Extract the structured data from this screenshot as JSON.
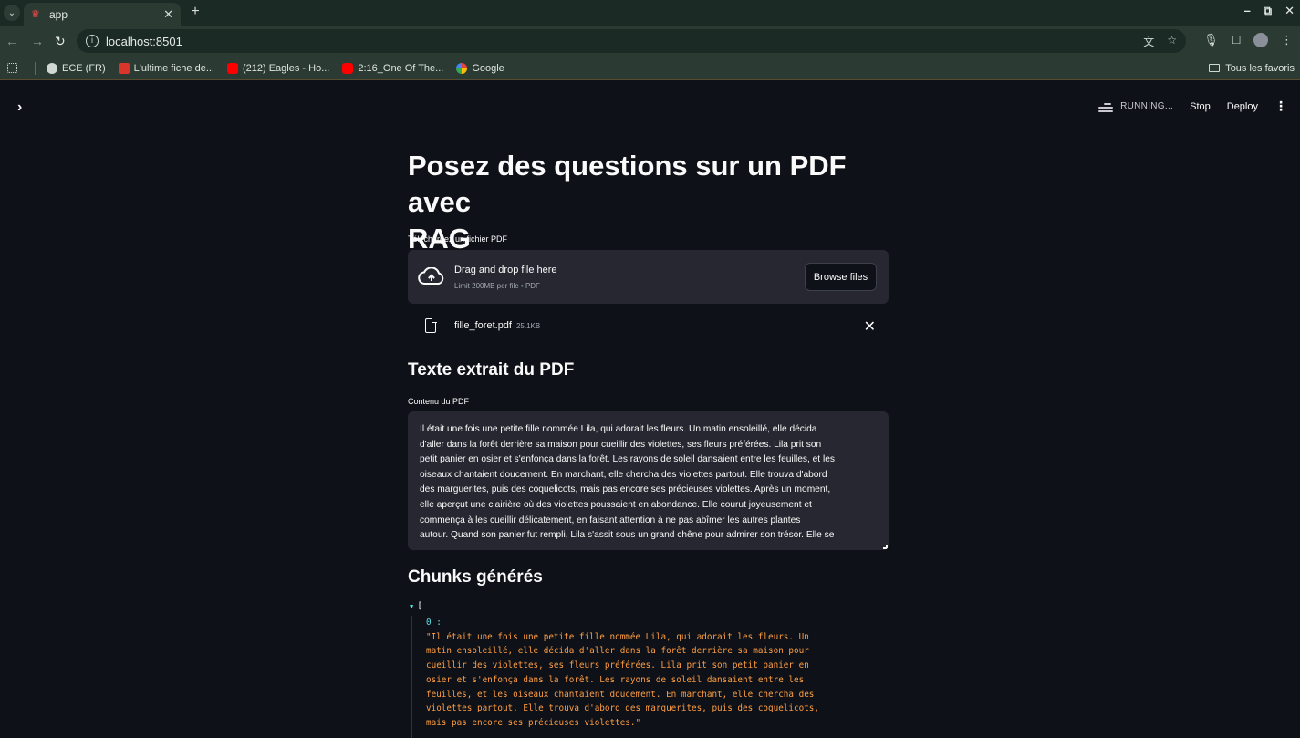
{
  "browser": {
    "tab_title": "app",
    "url": "localhost:8501",
    "bookmarks": [
      "ECE (FR)",
      "L'ultime fiche de...",
      "(212) Eagles - Ho...",
      "2:16_One Of The...",
      "Google"
    ],
    "all_bookmarks": "Tous les favoris"
  },
  "header": {
    "status": "RUNNING...",
    "stop": "Stop",
    "deploy": "Deploy"
  },
  "main": {
    "title_line1": "Posez des questions sur un PDF avec",
    "title_line2": "RAG",
    "uploader_label": "Téléchargez un fichier PDF",
    "dropzone_main": "Drag and drop file here",
    "dropzone_sub": "Limit 200MB per file • PDF",
    "browse_label": "Browse files",
    "file_name": "fille_foret.pdf",
    "file_size": "25.1KB",
    "extracted_heading": "Texte extrait du PDF",
    "content_label": "Contenu du PDF",
    "content_lines": [
      "Il était une fois une petite fille nommée Lila, qui adorait les fleurs. Un matin ensoleillé, elle décida",
      "d'aller dans la forêt derrière sa maison pour cueillir des violettes, ses fleurs préférées. Lila prit son",
      "petit panier en osier et s'enfonça dans la forêt. Les rayons de soleil dansaient entre les feuilles, et les",
      "oiseaux chantaient doucement. En marchant, elle chercha des violettes partout. Elle trouva d'abord",
      "des marguerites, puis des coquelicots, mais pas encore ses précieuses violettes. Après un moment,",
      "elle aperçut une clairière où des violettes poussaient en abondance. Elle courut joyeusement et",
      "commença à les cueillir délicatement, en faisant attention à ne pas abîmer les autres plantes",
      "autour. Quand son panier fut rempli, Lila s'assit sous un grand chêne pour admirer son trésor. Elle se"
    ],
    "chunks_heading": "Chunks générés",
    "json_open": "[",
    "json_key": "0 :",
    "chunk_lines": [
      "\"Il était une fois une petite fille nommée Lila, qui adorait les fleurs. Un",
      "matin ensoleillé, elle décida d'aller dans la forêt derrière sa maison pour",
      "cueillir des violettes, ses fleurs préférées. Lila prit son petit panier en",
      "osier et s'enfonça dans la forêt. Les rayons de soleil dansaient entre les",
      "feuilles, et les oiseaux chantaient doucement. En marchant, elle chercha des",
      "violettes partout. Elle trouva d'abord des marguerites, puis des coquelicots,",
      "mais pas encore ses précieuses violettes.\""
    ]
  },
  "colors": {
    "app_bg": "#0e1117",
    "panel_bg": "#262730",
    "json_key": "#5ce1e6",
    "json_string": "#ff9e44"
  }
}
